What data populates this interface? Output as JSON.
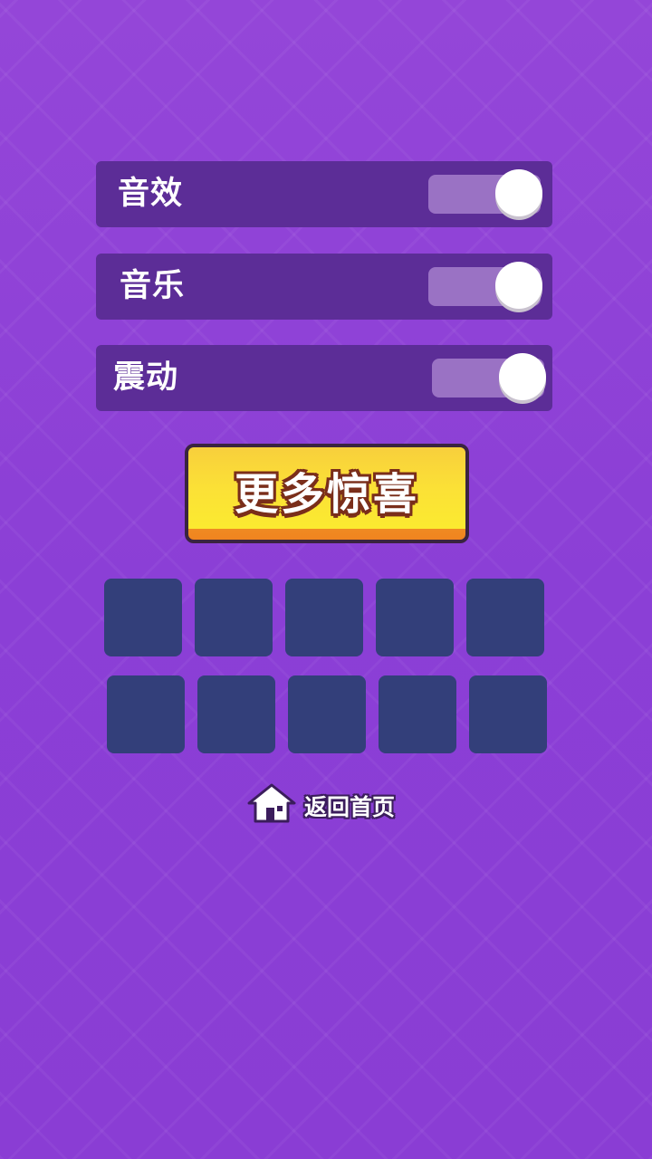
{
  "settings": {
    "sound_effects": {
      "label": "音效",
      "enabled": true
    },
    "music": {
      "label": "音乐",
      "enabled": true
    },
    "vibration": {
      "label": "震动",
      "enabled": true
    }
  },
  "more_button": {
    "label": "更多惊喜"
  },
  "tiles": {
    "row_count": 2,
    "per_row": 5
  },
  "home": {
    "label": "返回首页",
    "icon": "home-icon"
  },
  "colors": {
    "background": "#8a3fd6",
    "row": "#5c2d97",
    "toggle_track": "#9a72c4",
    "toggle_knob": "#ffffff",
    "button_yellow": "#fbe136",
    "button_orange": "#f0841f",
    "tile": "#333f7a"
  }
}
